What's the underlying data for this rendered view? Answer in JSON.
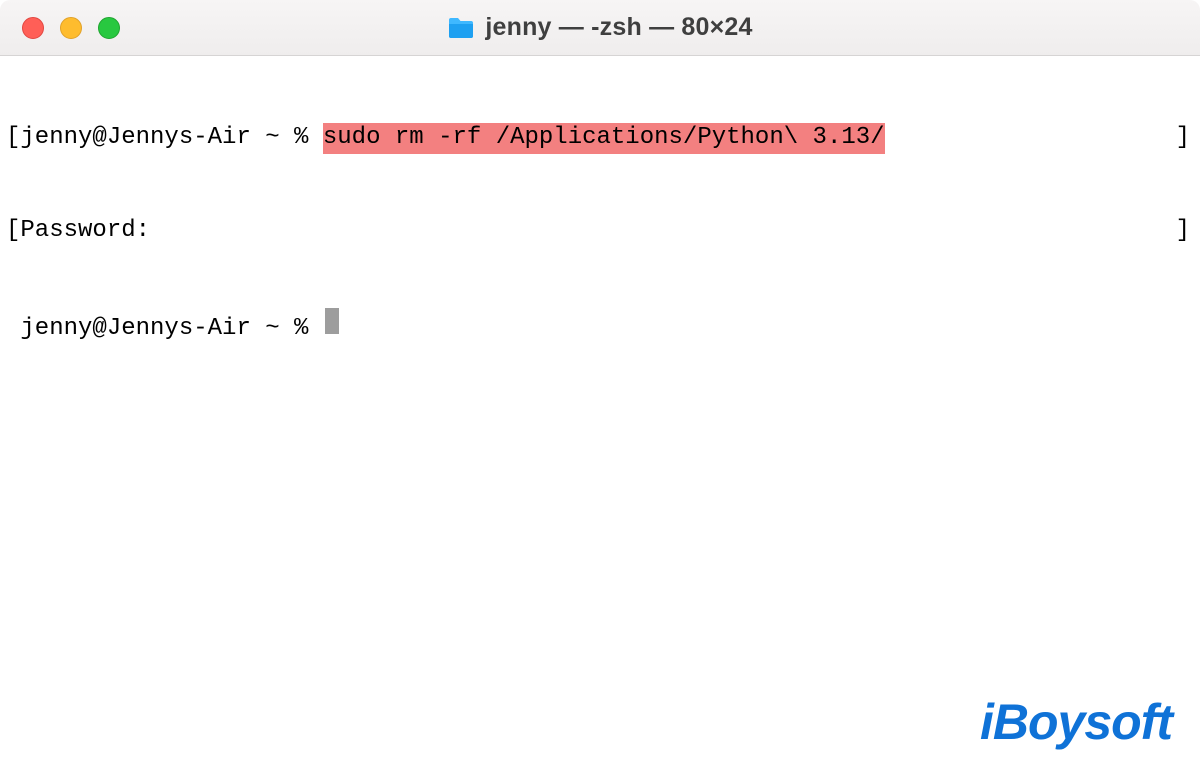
{
  "window": {
    "title": "jenny — -zsh — 80×24"
  },
  "traffic": {
    "close": "close",
    "min": "minimize",
    "zoom": "zoom"
  },
  "terminal": {
    "line1_prompt": "jenny@Jennys-Air ~ % ",
    "line1_command": "sudo rm -rf /Applications/Python\\ 3.13/",
    "line2": "Password:",
    "line3_prompt": "jenny@Jennys-Air ~ % "
  },
  "brackets": {
    "open": "[",
    "close": "]"
  },
  "watermark": {
    "text": "iBoysoft"
  }
}
